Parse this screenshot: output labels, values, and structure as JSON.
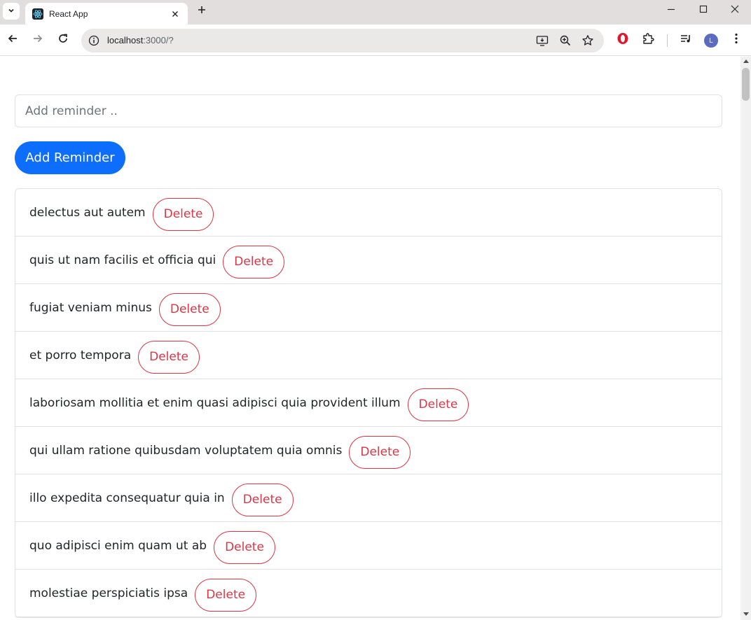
{
  "browser": {
    "tab_title": "React App",
    "url_host": "localhost",
    "url_rest": ":3000/?",
    "avatar_initial": "L"
  },
  "colors": {
    "primary": "#0d6efd",
    "danger": "#dc3545",
    "border": "#dee2e6",
    "text": "#212529"
  },
  "form": {
    "input_placeholder": "Add reminder ..",
    "input_value": "",
    "add_button_label": "Add Reminder"
  },
  "reminders": [
    {
      "title": "delectus aut autem",
      "delete_label": "Delete"
    },
    {
      "title": "quis ut nam facilis et officia qui",
      "delete_label": "Delete"
    },
    {
      "title": "fugiat veniam minus",
      "delete_label": "Delete"
    },
    {
      "title": "et porro tempora",
      "delete_label": "Delete"
    },
    {
      "title": "laboriosam mollitia et enim quasi adipisci quia provident illum",
      "delete_label": "Delete"
    },
    {
      "title": "qui ullam ratione quibusdam voluptatem quia omnis",
      "delete_label": "Delete"
    },
    {
      "title": "illo expedita consequatur quia in",
      "delete_label": "Delete"
    },
    {
      "title": "quo adipisci enim quam ut ab",
      "delete_label": "Delete"
    },
    {
      "title": "molestiae perspiciatis ipsa",
      "delete_label": "Delete"
    }
  ]
}
